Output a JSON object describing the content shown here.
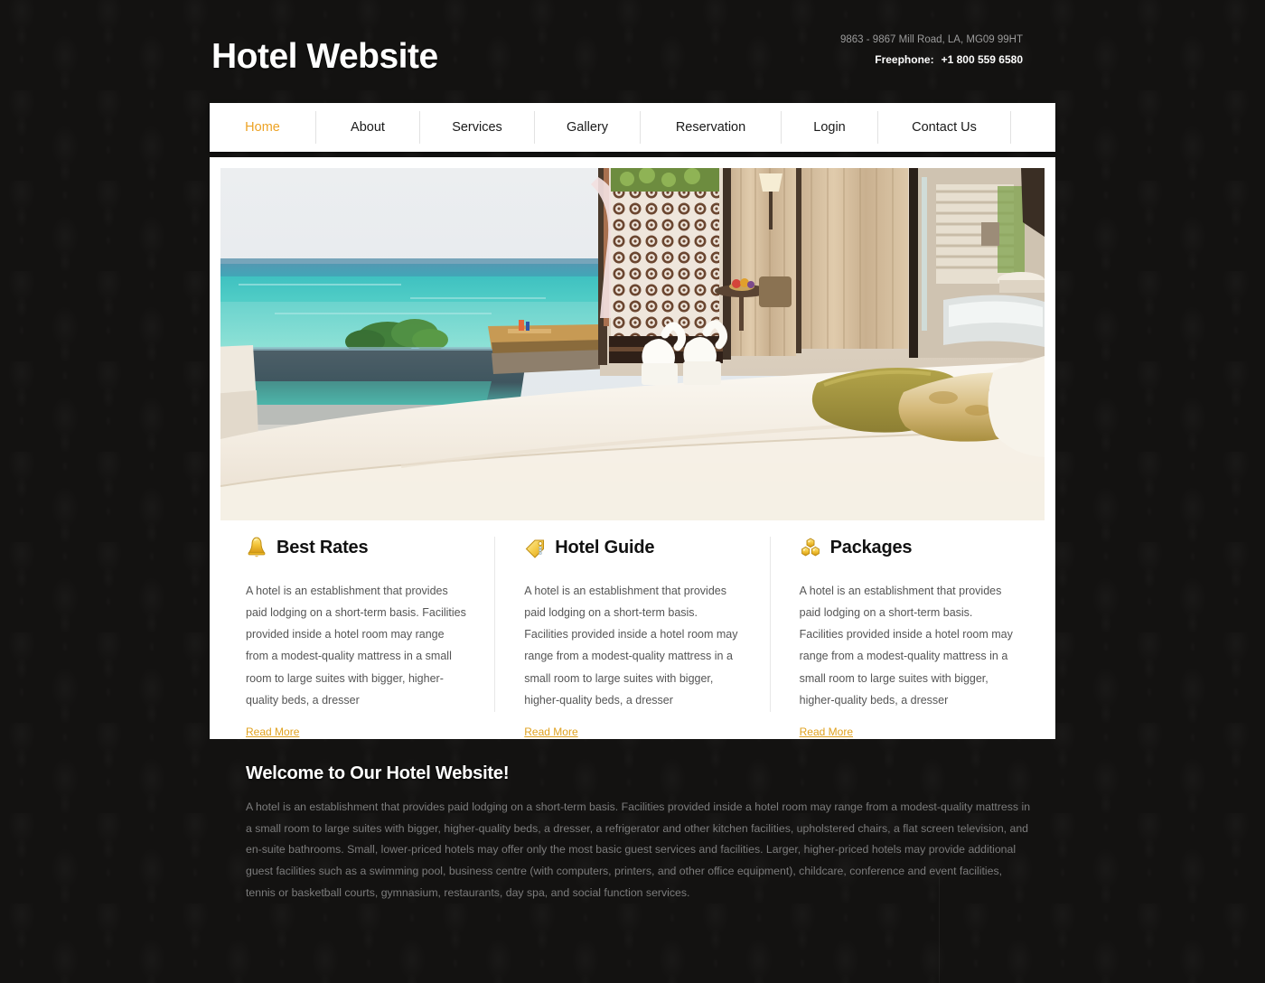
{
  "header": {
    "logo": "Hotel Website",
    "address": "9863 - 9867 Mill Road, LA, MG09 99HT",
    "phone_label": "Freephone:",
    "phone_number": "+1 800 559 6580"
  },
  "nav": {
    "items": [
      {
        "label": "Home",
        "active": true
      },
      {
        "label": "About",
        "active": false
      },
      {
        "label": "Services",
        "active": false
      },
      {
        "label": "Gallery",
        "active": false
      },
      {
        "label": "Reservation",
        "active": false
      },
      {
        "label": "Login",
        "active": false
      },
      {
        "label": "Contact Us",
        "active": false
      }
    ],
    "active_color": "#eda325",
    "text_color": "#1a1a1a",
    "background": "#ffffff"
  },
  "hero": {
    "alt": "Luxury hotel suite with ocean view, infinity pool, canopy bed and gold pillows"
  },
  "features": [
    {
      "icon": "bell-icon",
      "title": "Best Rates",
      "body": "A hotel is an establishment that provides paid lodging on a short-term basis. Facilities provided inside a hotel room may range from a modest-quality mattress in a small room to large suites with bigger, higher-quality beds, a dresser",
      "link": "Read More"
    },
    {
      "icon": "tag-icon",
      "title": "Hotel Guide",
      "body": "A hotel is an establishment that provides paid lodging on a short-term basis. Facilities provided inside a hotel room may range from a modest-quality mattress in a small room to large suites with bigger, higher-quality beds, a dresser",
      "link": "Read More"
    },
    {
      "icon": "honeycomb-icon",
      "title": "Packages",
      "body": "A hotel is an establishment that provides paid lodging on a short-term basis. Facilities provided inside a hotel room may range from a modest-quality mattress in a small room to large suites with bigger, higher-quality beds, a dresser",
      "link": "Read More"
    }
  ],
  "welcome": {
    "title": "Welcome to Our Hotel Website!",
    "body": "A hotel is an establishment that provides paid lodging on a short-term basis. Facilities provided inside a hotel room may range from a modest-quality mattress in a small room to large suites with bigger, higher-quality beds, a dresser, a refrigerator and other kitchen facilities, upholstered chairs, a flat screen television, and en-suite bathrooms. Small, lower-priced hotels may offer only the most basic guest services and facilities. Larger, higher-priced hotels may provide additional guest facilities such as a swimming pool, business centre (with computers, printers, and other office equipment), childcare, conference and event facilities, tennis or basketball courts, gymnasium, restaurants, day spa, and social function services."
  },
  "colors": {
    "accent": "#eda325",
    "link": "#e0a21f",
    "page_background": "#131211",
    "panel": "#ffffff",
    "muted_text": "#7c7c7c"
  }
}
